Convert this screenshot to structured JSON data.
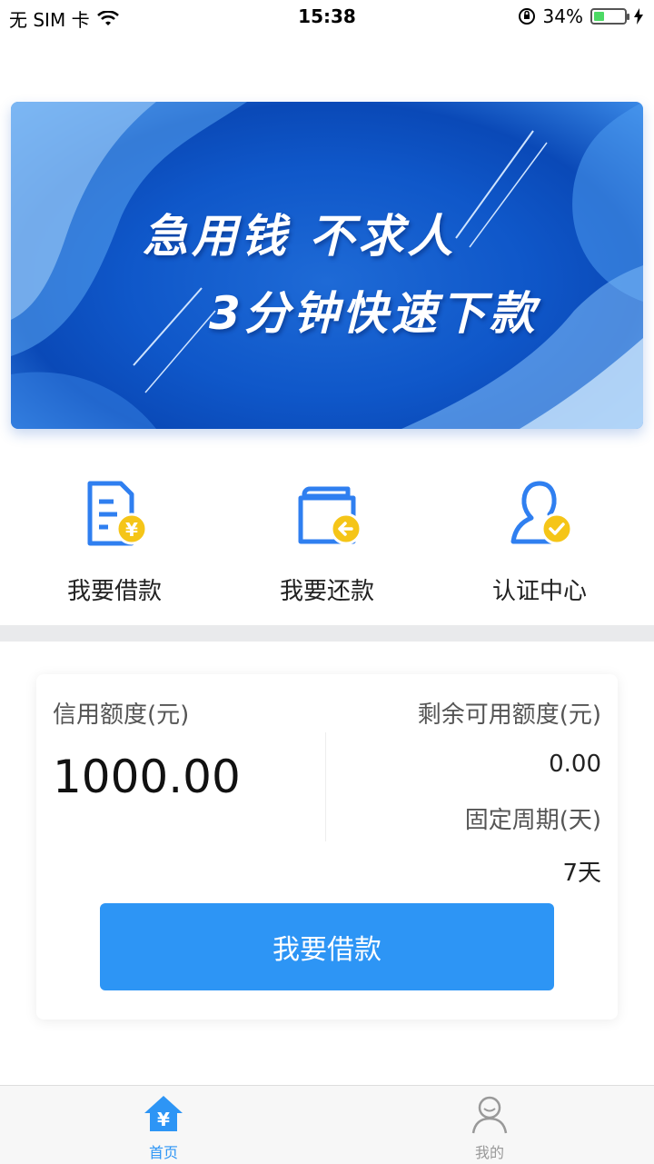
{
  "status_bar": {
    "carrier": "无 SIM 卡",
    "time": "15:38",
    "battery_percent": "34%",
    "battery_level": 0.34,
    "battery_color": "#4cd964"
  },
  "banner": {
    "line1": "急用钱 不求人",
    "line2": "3分钟快速下款"
  },
  "quick_menu": [
    {
      "label": "我要借款",
      "icon": "loan-document-icon"
    },
    {
      "label": "我要还款",
      "icon": "repay-wallet-icon"
    },
    {
      "label": "认证中心",
      "icon": "verified-user-icon"
    }
  ],
  "card": {
    "credit_label": "信用额度(元)",
    "credit_value": "1000.00",
    "remain_label": "剩余可用额度(元)",
    "remain_value": "0.00",
    "period_label": "固定周期(天)",
    "period_value": "7天",
    "button_label": "我要借款"
  },
  "tab_bar": {
    "tabs": [
      {
        "label": "首页",
        "icon": "home-yen-icon",
        "active": true,
        "color": "#2d95f5"
      },
      {
        "label": "我的",
        "icon": "user-icon",
        "active": false,
        "color": "#999999"
      }
    ]
  },
  "colors": {
    "accent": "#2d95f5",
    "icon_blue": "#2f7ff0",
    "icon_yellow": "#f5c518"
  }
}
